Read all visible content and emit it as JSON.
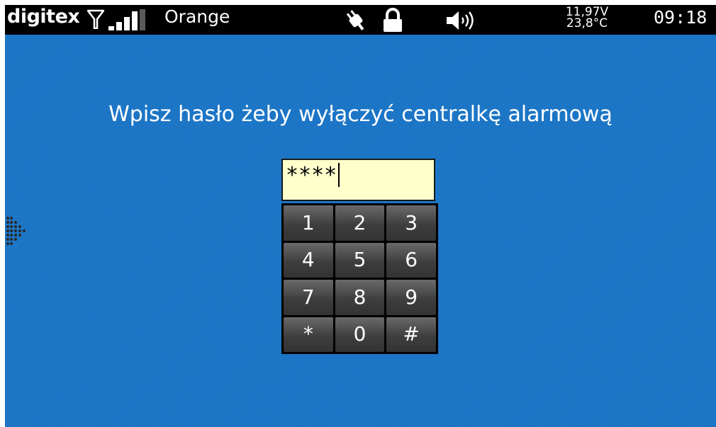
{
  "status_bar": {
    "brand": "digitex",
    "operator": "Orange",
    "voltage": "11,97V",
    "temperature": "23,8°C",
    "time": "09:18",
    "icons": [
      "antenna-icon",
      "signal-strength-icon",
      "power-plug-icon",
      "lock-icon",
      "speaker-icon"
    ],
    "signal_level": "4 of 5 bars"
  },
  "prompt": "Wpisz hasło żeby wyłączyć centralkę alarmową",
  "password_field": {
    "value": "****"
  },
  "keypad": {
    "keys": [
      "1",
      "2",
      "3",
      "4",
      "5",
      "6",
      "7",
      "8",
      "9",
      "*",
      "0",
      "#"
    ]
  },
  "colors": {
    "background": "#1a74c5",
    "status_bar": "#000000",
    "input_background": "#ffffcc",
    "key": "#4a4a4a"
  }
}
